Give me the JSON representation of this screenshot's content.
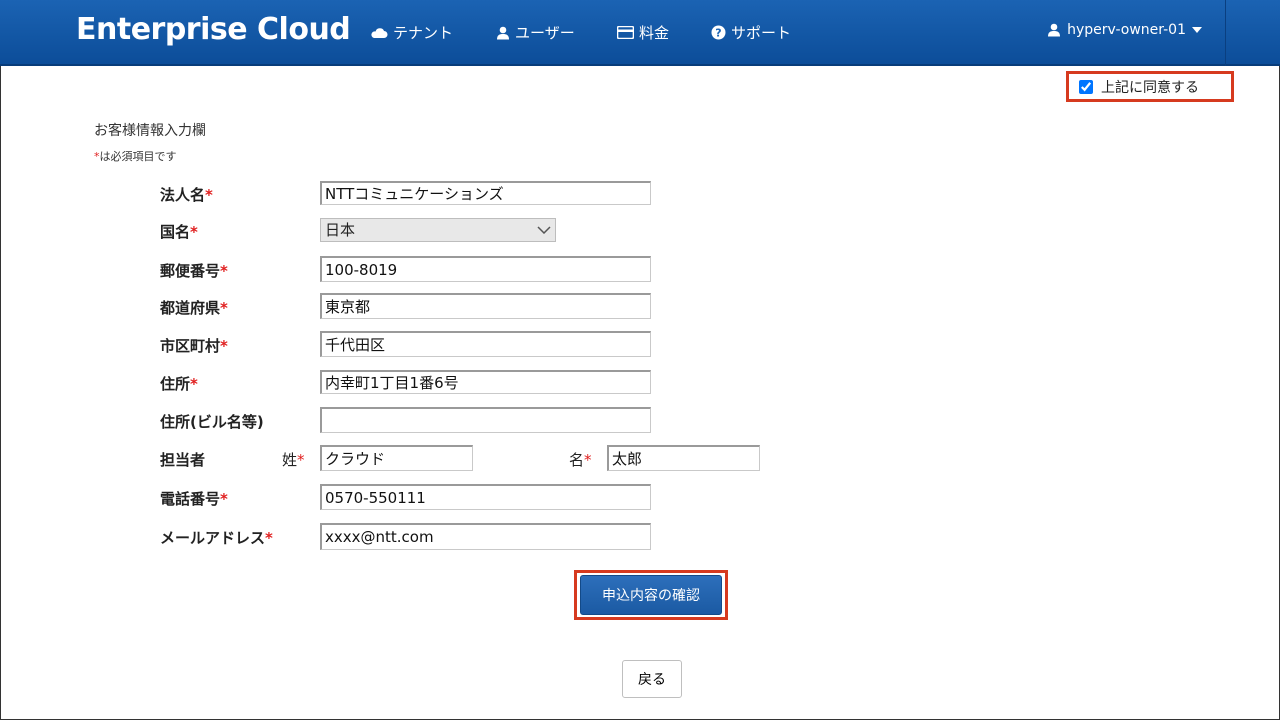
{
  "navbar": {
    "brand": "Enterprise Cloud",
    "items": [
      {
        "label": "テナント",
        "icon": "cloud-icon"
      },
      {
        "label": "ユーザー",
        "icon": "user-icon"
      },
      {
        "label": "料金",
        "icon": "card-icon"
      },
      {
        "label": "サポート",
        "icon": "help-icon"
      }
    ],
    "user": "hyperv-owner-01"
  },
  "agreement": {
    "label": "上記に同意する",
    "checked": true
  },
  "form": {
    "title": "お客様情報入力欄",
    "required_note_star": "*",
    "required_note": "は必須項目です",
    "required_star": "*",
    "fields": {
      "company": {
        "label": "法人名",
        "value": "NTTコミュニケーションズ"
      },
      "country": {
        "label": "国名",
        "value": "日本"
      },
      "postal": {
        "label": "郵便番号",
        "value": "100-8019"
      },
      "prefecture": {
        "label": "都道府県",
        "value": "東京都"
      },
      "city": {
        "label": "市区町村",
        "value": "千代田区"
      },
      "address": {
        "label": "住所",
        "value": "内幸町1丁目1番6号"
      },
      "building": {
        "label": "住所(ビル名等)",
        "value": ""
      },
      "contact": {
        "label": "担当者",
        "last_label": "姓",
        "last_value": "クラウド",
        "first_label": "名",
        "first_value": "太郎"
      },
      "phone": {
        "label": "電話番号",
        "value": "0570-550111"
      },
      "email": {
        "label": "メールアドレス",
        "value": "xxxx@ntt.com"
      }
    },
    "confirm_button": "申込内容の確認",
    "back_button": "戻る"
  },
  "colors": {
    "nav": "#1b63b3",
    "highlight": "#d63a1f",
    "required": "#e01f1f",
    "primary_button": "#1b5aa3"
  }
}
